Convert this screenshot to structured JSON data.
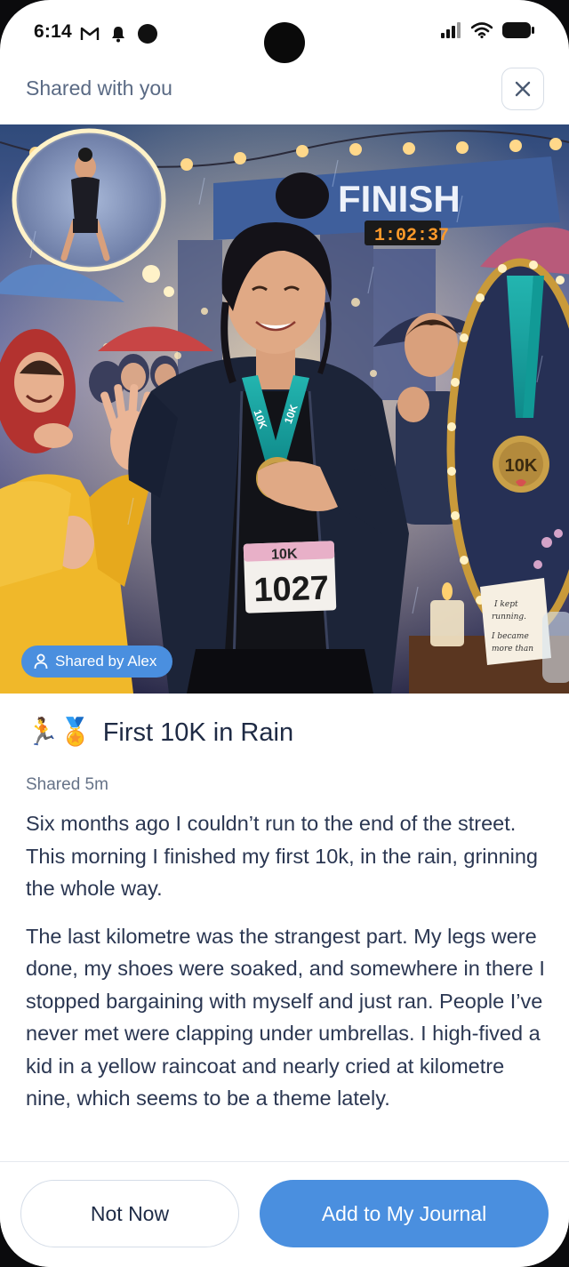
{
  "status_bar": {
    "time": "6:14",
    "left_icons": [
      "gmail-icon",
      "bell-icon",
      "dot-icon"
    ],
    "right_icons": [
      "signal-icon",
      "wifi-icon",
      "battery-icon"
    ]
  },
  "header": {
    "title": "Shared with you",
    "close_icon": "close-icon"
  },
  "hero": {
    "finish_banner": "FINISH",
    "clock": "1:02:37",
    "bib_distance": "10K",
    "bib_number": "1027",
    "medal_text": "10K",
    "note_text": "I kept running. I became more than I knew.",
    "badge_icon": "user-icon",
    "badge_label": "Shared by Alex"
  },
  "post": {
    "emoji": "🏃🏅",
    "title": "First 10K in Rain",
    "meta": "Shared 5m",
    "paragraphs": [
      "Six months ago I couldn’t run to the end of the street. This morning I finished my first 10k, in the rain, grinning the whole way.",
      "The last kilometre was the strangest part. My legs were done, my shoes were soaked, and somewhere in there I stopped bargaining with myself and just ran. People I’ve never met were clapping under umbrellas. I high-fived a kid in a yellow raincoat and nearly cried at kilometre nine, which seems to be a theme lately."
    ]
  },
  "footer": {
    "secondary_label": "Not Now",
    "primary_label": "Add to My Journal"
  },
  "colors": {
    "accent": "#4a8fdf",
    "title_text": "#1e2a44",
    "muted_text": "#667388"
  }
}
